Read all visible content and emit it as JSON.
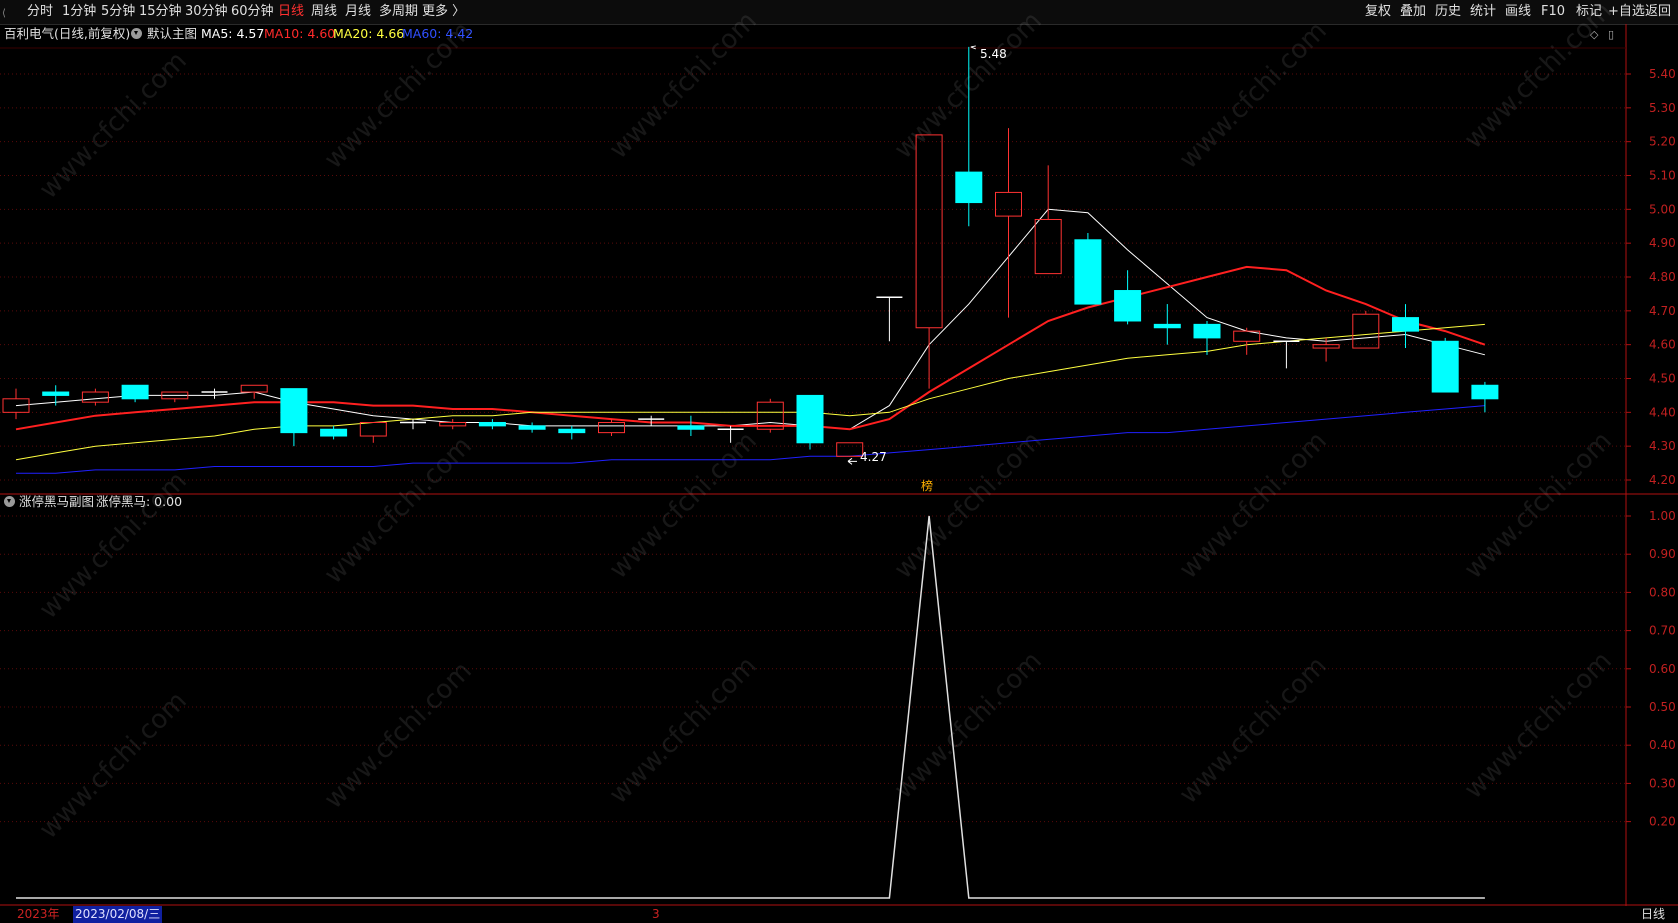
{
  "toolbar": {
    "left_items": [
      "分时",
      "1分钟",
      "5分钟",
      "15分钟",
      "30分钟",
      "60分钟",
      "日线",
      "周线",
      "月线",
      "多周期",
      "更多 〉"
    ],
    "active_item": "日线",
    "right_items": [
      "复权",
      "叠加",
      "历史",
      "统计",
      "画线",
      "F10",
      "标记",
      "+自选",
      "返回"
    ]
  },
  "main_info": {
    "stock_title": "百利电气(日线,前复权)",
    "chart_name": "默认主图",
    "ma5": "MA5: 4.57",
    "ma10": "MA10: 4.60",
    "ma20": "MA20: 4.66",
    "ma60": "MA60: 4.42"
  },
  "sub_info": {
    "chart_name": "涨停黑马副图",
    "indicator": "涨停黑马: 0.00"
  },
  "markers": {
    "high_label": "5.48",
    "low_label": "4.27",
    "badge": "榜"
  },
  "bottom": {
    "year": "2023年",
    "date": "2023/02/08/三",
    "month": "3",
    "period": "日线"
  },
  "watermark": "www.cfchi.com",
  "colors": {
    "up": "#ff3232",
    "down": "#00ffff",
    "ma5": "#ffffff",
    "ma10": "#ff2020",
    "ma20": "#ffff40",
    "ma60": "#2020ff",
    "axis": "#b01010"
  },
  "chart_data": [
    {
      "type": "candlestick",
      "title": "百利电气(日线,前复权)",
      "ylim": [
        4.17,
        5.56
      ],
      "y_ticks": [
        "5.40",
        "5.30",
        "5.20",
        "5.10",
        "5.00",
        "4.90",
        "4.80",
        "4.70",
        "4.60",
        "4.50",
        "4.40",
        "4.30",
        "4.20"
      ],
      "candles": [
        {
          "o": 4.4,
          "h": 4.47,
          "l": 4.38,
          "c": 4.44
        },
        {
          "o": 4.46,
          "h": 4.48,
          "l": 4.42,
          "c": 4.45
        },
        {
          "o": 4.43,
          "h": 4.47,
          "l": 4.42,
          "c": 4.46
        },
        {
          "o": 4.48,
          "h": 4.48,
          "l": 4.43,
          "c": 4.44
        },
        {
          "o": 4.44,
          "h": 4.46,
          "l": 4.43,
          "c": 4.46
        },
        {
          "o": 4.46,
          "h": 4.47,
          "l": 4.44,
          "c": 4.46
        },
        {
          "o": 4.46,
          "h": 4.48,
          "l": 4.44,
          "c": 4.48
        },
        {
          "o": 4.47,
          "h": 4.47,
          "l": 4.3,
          "c": 4.34
        },
        {
          "o": 4.35,
          "h": 4.36,
          "l": 4.32,
          "c": 4.33
        },
        {
          "o": 4.33,
          "h": 4.37,
          "l": 4.31,
          "c": 4.37
        },
        {
          "o": 4.37,
          "h": 4.38,
          "l": 4.35,
          "c": 4.37
        },
        {
          "o": 4.36,
          "h": 4.38,
          "l": 4.35,
          "c": 4.37
        },
        {
          "o": 4.37,
          "h": 4.38,
          "l": 4.35,
          "c": 4.36
        },
        {
          "o": 4.36,
          "h": 4.37,
          "l": 4.34,
          "c": 4.35
        },
        {
          "o": 4.35,
          "h": 4.36,
          "l": 4.32,
          "c": 4.34
        },
        {
          "o": 4.34,
          "h": 4.38,
          "l": 4.33,
          "c": 4.37
        },
        {
          "o": 4.38,
          "h": 4.39,
          "l": 4.36,
          "c": 4.38
        },
        {
          "o": 4.36,
          "h": 4.39,
          "l": 4.33,
          "c": 4.35
        },
        {
          "o": 4.35,
          "h": 4.36,
          "l": 4.31,
          "c": 4.35
        },
        {
          "o": 4.35,
          "h": 4.44,
          "l": 4.34,
          "c": 4.43
        },
        {
          "o": 4.45,
          "h": 4.45,
          "l": 4.29,
          "c": 4.31
        },
        {
          "o": 4.27,
          "h": 4.31,
          "l": 4.27,
          "c": 4.31
        },
        {
          "o": 4.74,
          "h": 4.74,
          "l": 4.61,
          "c": 4.74
        },
        {
          "o": 4.65,
          "h": 5.22,
          "l": 4.47,
          "c": 5.22
        },
        {
          "o": 5.11,
          "h": 5.48,
          "l": 4.95,
          "c": 5.02
        },
        {
          "o": 4.98,
          "h": 5.24,
          "l": 4.68,
          "c": 5.05
        },
        {
          "o": 4.81,
          "h": 5.13,
          "l": 4.81,
          "c": 4.97
        },
        {
          "o": 4.91,
          "h": 4.93,
          "l": 4.72,
          "c": 4.72
        },
        {
          "o": 4.76,
          "h": 4.82,
          "l": 4.66,
          "c": 4.67
        },
        {
          "o": 4.66,
          "h": 4.72,
          "l": 4.6,
          "c": 4.65
        },
        {
          "o": 4.66,
          "h": 4.67,
          "l": 4.57,
          "c": 4.62
        },
        {
          "o": 4.61,
          "h": 4.65,
          "l": 4.57,
          "c": 4.64
        },
        {
          "o": 4.61,
          "h": 4.61,
          "l": 4.53,
          "c": 4.61
        },
        {
          "o": 4.59,
          "h": 4.62,
          "l": 4.55,
          "c": 4.6
        },
        {
          "o": 4.59,
          "h": 4.7,
          "l": 4.59,
          "c": 4.69
        },
        {
          "o": 4.68,
          "h": 4.72,
          "l": 4.59,
          "c": 4.64
        },
        {
          "o": 4.61,
          "h": 4.62,
          "l": 4.46,
          "c": 4.46
        },
        {
          "o": 4.48,
          "h": 4.49,
          "l": 4.4,
          "c": 4.44
        }
      ],
      "ma_lines": {
        "MA5": [
          4.42,
          4.43,
          4.44,
          4.45,
          4.45,
          4.45,
          4.46,
          4.43,
          4.41,
          4.39,
          4.38,
          4.37,
          4.37,
          4.36,
          4.36,
          4.36,
          4.36,
          4.36,
          4.36,
          4.37,
          4.36,
          4.35,
          4.42,
          4.6,
          4.72,
          4.86,
          5.0,
          4.99,
          4.88,
          4.78,
          4.68,
          4.64,
          4.62,
          4.61,
          4.62,
          4.63,
          4.6,
          4.57
        ],
        "MA10": [
          4.35,
          4.37,
          4.39,
          4.4,
          4.41,
          4.42,
          4.43,
          4.43,
          4.43,
          4.42,
          4.42,
          4.41,
          4.41,
          4.4,
          4.39,
          4.38,
          4.37,
          4.37,
          4.36,
          4.36,
          4.36,
          4.35,
          4.38,
          4.46,
          4.53,
          4.6,
          4.67,
          4.71,
          4.74,
          4.77,
          4.8,
          4.83,
          4.82,
          4.76,
          4.72,
          4.67,
          4.64,
          4.6
        ],
        "MA20": [
          4.26,
          4.28,
          4.3,
          4.31,
          4.32,
          4.33,
          4.35,
          4.36,
          4.36,
          4.37,
          4.38,
          4.39,
          4.39,
          4.4,
          4.4,
          4.4,
          4.4,
          4.4,
          4.4,
          4.4,
          4.4,
          4.39,
          4.4,
          4.44,
          4.47,
          4.5,
          4.52,
          4.54,
          4.56,
          4.57,
          4.58,
          4.6,
          4.61,
          4.62,
          4.63,
          4.64,
          4.65,
          4.66
        ],
        "MA60": [
          4.22,
          4.22,
          4.23,
          4.23,
          4.23,
          4.24,
          4.24,
          4.24,
          4.24,
          4.24,
          4.25,
          4.25,
          4.25,
          4.25,
          4.25,
          4.26,
          4.26,
          4.26,
          4.26,
          4.26,
          4.27,
          4.27,
          4.28,
          4.29,
          4.3,
          4.31,
          4.32,
          4.33,
          4.34,
          4.34,
          4.35,
          4.36,
          4.37,
          4.38,
          4.39,
          4.4,
          4.41,
          4.42
        ]
      }
    },
    {
      "type": "line",
      "title": "涨停黑马副图",
      "ylim": [
        0,
        1.02
      ],
      "y_ticks": [
        "1.00",
        "0.90",
        "0.80",
        "0.70",
        "0.60",
        "0.50",
        "0.40",
        "0.30",
        "0.20"
      ],
      "series": [
        {
          "name": "涨停黑马",
          "values": [
            0,
            0,
            0,
            0,
            0,
            0,
            0,
            0,
            0,
            0,
            0,
            0,
            0,
            0,
            0,
            0,
            0,
            0,
            0,
            0,
            0,
            0,
            0,
            1,
            0,
            0,
            0,
            0,
            0,
            0,
            0,
            0,
            0,
            0,
            0,
            0,
            0,
            0
          ]
        }
      ]
    }
  ]
}
